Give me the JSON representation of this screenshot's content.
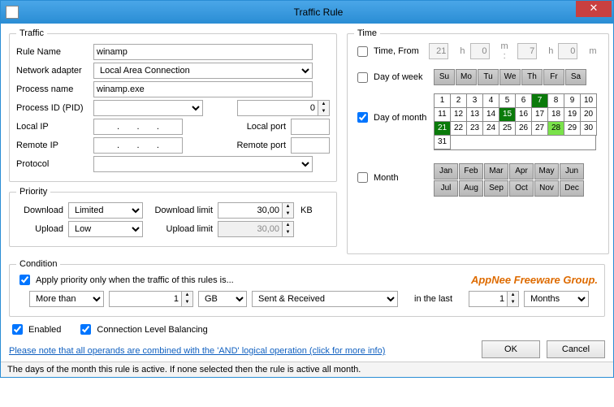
{
  "window": {
    "title": "Traffic Rule"
  },
  "traffic": {
    "legend": "Traffic",
    "rule_name_label": "Rule Name",
    "rule_name": "winamp",
    "adapter_label": "Network adapter",
    "adapter": "Local Area Connection",
    "process_label": "Process name",
    "process": "winamp.exe",
    "pid_label": "Process ID (PID)",
    "pid": "",
    "pid_num": "0",
    "local_ip_label": "Local IP",
    "local_ip": ".       .       .",
    "local_port_label": "Local port",
    "local_port": "",
    "remote_ip_label": "Remote IP",
    "remote_ip": ".       .       .",
    "remote_port_label": "Remote port",
    "remote_port": "",
    "protocol_label": "Protocol",
    "protocol": ""
  },
  "priority": {
    "legend": "Priority",
    "download_label": "Download",
    "download": "Limited",
    "dl_limit_label": "Download limit",
    "dl_limit": "30,00",
    "upload_label": "Upload",
    "upload": "Low",
    "ul_limit_label": "Upload limit",
    "ul_limit": "30,00",
    "unit": "KB"
  },
  "time": {
    "legend": "Time",
    "time_from_label": "Time, From",
    "h1": "21",
    "m1": "0",
    "h2": "7",
    "m2": "0",
    "dow_label": "Day of week",
    "dow": [
      "Su",
      "Mo",
      "Tu",
      "We",
      "Th",
      "Fr",
      "Sa"
    ],
    "dom_label": "Day of month",
    "dom_checked": true,
    "dom_selected_dark": [
      7,
      15,
      21
    ],
    "dom_selected_light": [
      28
    ],
    "month_label": "Month",
    "months": [
      "Jan",
      "Feb",
      "Mar",
      "Apr",
      "May",
      "Jun",
      "Jul",
      "Aug",
      "Sep",
      "Oct",
      "Nov",
      "Dec"
    ]
  },
  "condition": {
    "legend": "Condition",
    "apply_label": "Apply priority only when the traffic of this rules is...",
    "apply_checked": true,
    "op": "More than",
    "amount": "1",
    "unit": "GB",
    "direction": "Sent & Received",
    "in_last_label": "in the last",
    "in_last": "1",
    "in_last_unit": "Months"
  },
  "footer": {
    "enabled_label": "Enabled",
    "enabled": true,
    "balancing_label": "Connection Level Balancing",
    "balancing": true,
    "note": "Please note that all operands are combined with the 'AND' logical operation (click for more info)",
    "ok": "OK",
    "cancel": "Cancel"
  },
  "watermark": "AppNee Freeware Group.",
  "statusbar": "The days of the month this rule is active. If none selected then the rule is active all month."
}
